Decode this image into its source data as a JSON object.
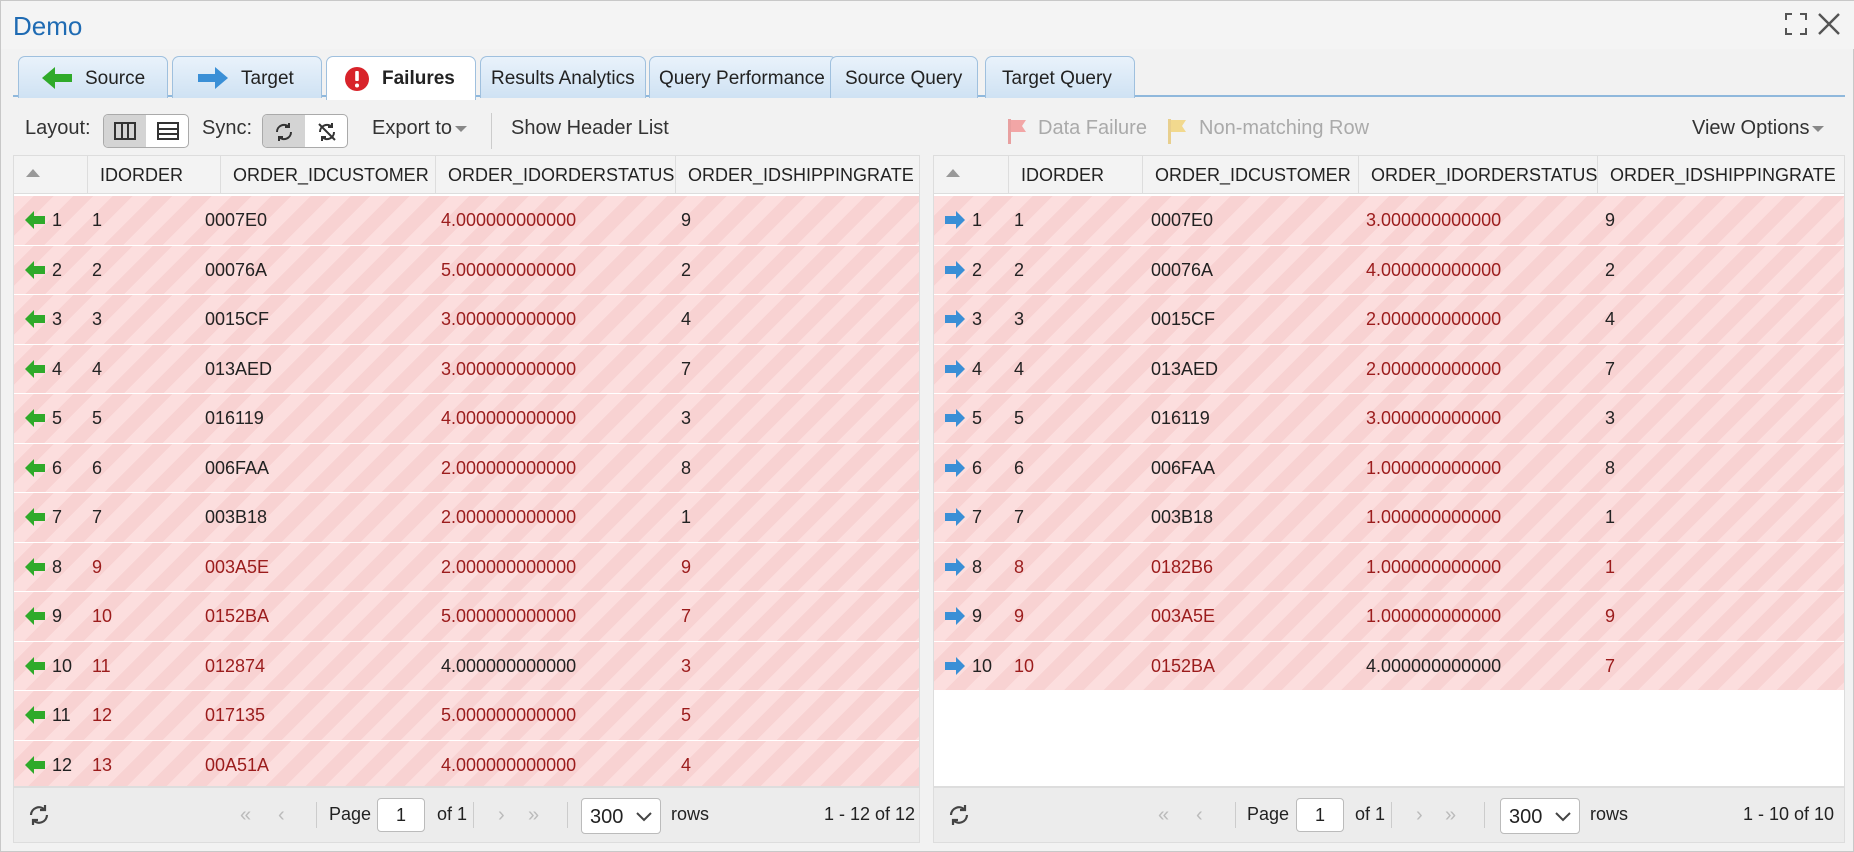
{
  "window": {
    "title": "Demo"
  },
  "tabs": [
    {
      "label": "Source",
      "icon": "arrow-left-green-icon"
    },
    {
      "label": "Target",
      "icon": "arrow-right-blue-icon"
    },
    {
      "label": "Failures",
      "icon": "alert-icon",
      "active": true
    },
    {
      "label": "Results Analytics"
    },
    {
      "label": "Query Performance"
    },
    {
      "label": "Source Query"
    },
    {
      "label": "Target Query"
    }
  ],
  "toolbar": {
    "layout_label": "Layout:",
    "sync_label": "Sync:",
    "export_label": "Export to",
    "show_header_label": "Show Header List",
    "data_failure_label": "Data Failure",
    "non_matching_label": "Non-matching Row",
    "view_options_label": "View Options"
  },
  "colors": {
    "failure_row": "#fcdede",
    "mismatch_text": "#9b1c1c",
    "tab_accent": "#1f6bb3",
    "source_arrow": "#2faa2a",
    "target_arrow": "#3a8fd6"
  },
  "columns": [
    "IDORDER",
    "ORDER_IDCUSTOMER",
    "ORDER_IDORDERSTATUS",
    "ORDER_IDSHIPPINGRATE"
  ],
  "source": {
    "rows": [
      {
        "n": "1",
        "idorder": "1",
        "cust": "0007E0",
        "status": "4.000000000000",
        "ship": "9",
        "red": [
          0,
          0,
          1,
          0
        ]
      },
      {
        "n": "2",
        "idorder": "2",
        "cust": "00076A",
        "status": "5.000000000000",
        "ship": "2",
        "red": [
          0,
          0,
          1,
          0
        ]
      },
      {
        "n": "3",
        "idorder": "3",
        "cust": "0015CF",
        "status": "3.000000000000",
        "ship": "4",
        "red": [
          0,
          0,
          1,
          0
        ]
      },
      {
        "n": "4",
        "idorder": "4",
        "cust": "013AED",
        "status": "3.000000000000",
        "ship": "7",
        "red": [
          0,
          0,
          1,
          0
        ]
      },
      {
        "n": "5",
        "idorder": "5",
        "cust": "016119",
        "status": "4.000000000000",
        "ship": "3",
        "red": [
          0,
          0,
          1,
          0
        ]
      },
      {
        "n": "6",
        "idorder": "6",
        "cust": "006FAA",
        "status": "2.000000000000",
        "ship": "8",
        "red": [
          0,
          0,
          1,
          0
        ]
      },
      {
        "n": "7",
        "idorder": "7",
        "cust": "003B18",
        "status": "2.000000000000",
        "ship": "1",
        "red": [
          0,
          0,
          1,
          0
        ]
      },
      {
        "n": "8",
        "idorder": "9",
        "cust": "003A5E",
        "status": "2.000000000000",
        "ship": "9",
        "red": [
          1,
          1,
          1,
          1
        ]
      },
      {
        "n": "9",
        "idorder": "10",
        "cust": "0152BA",
        "status": "5.000000000000",
        "ship": "7",
        "red": [
          1,
          1,
          1,
          1
        ]
      },
      {
        "n": "10",
        "idorder": "11",
        "cust": "012874",
        "status": "4.000000000000",
        "ship": "3",
        "red": [
          1,
          1,
          0,
          1
        ]
      },
      {
        "n": "11",
        "idorder": "12",
        "cust": "017135",
        "status": "5.000000000000",
        "ship": "5",
        "red": [
          1,
          1,
          1,
          1
        ]
      },
      {
        "n": "12",
        "idorder": "13",
        "cust": "00A51A",
        "status": "4.000000000000",
        "ship": "4",
        "red": [
          1,
          1,
          1,
          1
        ]
      }
    ],
    "pager": {
      "page_label": "Page",
      "page_value": "1",
      "of_label": "of 1",
      "rows_value": "300",
      "rows_label": "rows",
      "summary": "1 - 12 of 12"
    }
  },
  "target": {
    "rows": [
      {
        "n": "1",
        "idorder": "1",
        "cust": "0007E0",
        "status": "3.000000000000",
        "ship": "9",
        "red": [
          0,
          0,
          1,
          0
        ]
      },
      {
        "n": "2",
        "idorder": "2",
        "cust": "00076A",
        "status": "4.000000000000",
        "ship": "2",
        "red": [
          0,
          0,
          1,
          0
        ]
      },
      {
        "n": "3",
        "idorder": "3",
        "cust": "0015CF",
        "status": "2.000000000000",
        "ship": "4",
        "red": [
          0,
          0,
          1,
          0
        ]
      },
      {
        "n": "4",
        "idorder": "4",
        "cust": "013AED",
        "status": "2.000000000000",
        "ship": "7",
        "red": [
          0,
          0,
          1,
          0
        ]
      },
      {
        "n": "5",
        "idorder": "5",
        "cust": "016119",
        "status": "3.000000000000",
        "ship": "3",
        "red": [
          0,
          0,
          1,
          0
        ]
      },
      {
        "n": "6",
        "idorder": "6",
        "cust": "006FAA",
        "status": "1.000000000000",
        "ship": "8",
        "red": [
          0,
          0,
          1,
          0
        ]
      },
      {
        "n": "7",
        "idorder": "7",
        "cust": "003B18",
        "status": "1.000000000000",
        "ship": "1",
        "red": [
          0,
          0,
          1,
          0
        ]
      },
      {
        "n": "8",
        "idorder": "8",
        "cust": "0182B6",
        "status": "1.000000000000",
        "ship": "1",
        "red": [
          1,
          1,
          1,
          1
        ]
      },
      {
        "n": "9",
        "idorder": "9",
        "cust": "003A5E",
        "status": "1.000000000000",
        "ship": "9",
        "red": [
          1,
          1,
          1,
          1
        ]
      },
      {
        "n": "10",
        "idorder": "10",
        "cust": "0152BA",
        "status": "4.000000000000",
        "ship": "7",
        "red": [
          1,
          1,
          0,
          1
        ]
      }
    ],
    "pager": {
      "page_label": "Page",
      "page_value": "1",
      "of_label": "of 1",
      "rows_value": "300",
      "rows_label": "rows",
      "summary": "1 - 10 of 10"
    }
  }
}
